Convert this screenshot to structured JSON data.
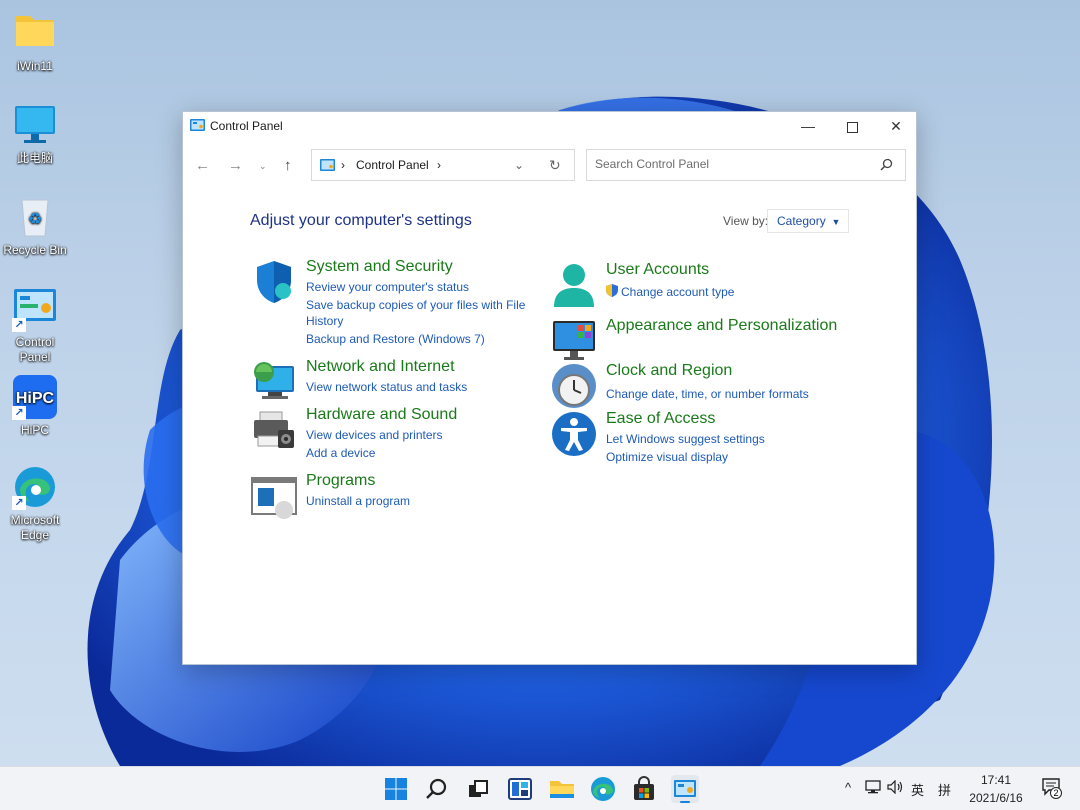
{
  "desktop_icons": [
    {
      "label": "iWin11",
      "icon": "folder-icon"
    },
    {
      "label": "此电脑",
      "icon": "monitor-icon"
    },
    {
      "label": "Recycle Bin",
      "icon": "recycle-bin-icon"
    },
    {
      "label": "Control Panel",
      "icon": "control-panel-icon"
    },
    {
      "label": "HiPC",
      "icon": "hipc-icon"
    },
    {
      "label": "Microsoft Edge",
      "icon": "edge-icon"
    }
  ],
  "window": {
    "title": "Control Panel",
    "address": {
      "crumb": "Control Panel"
    },
    "search": {
      "placeholder": "Search Control Panel"
    },
    "heading": "Adjust your computer's settings",
    "view_by": {
      "label": "View by:",
      "value": "Category"
    }
  },
  "categories": {
    "system_security": {
      "title": "System and Security",
      "links": [
        "Review your computer's status",
        "Save backup copies of your files with File",
        "History",
        "Backup and Restore (Windows 7)"
      ]
    },
    "network": {
      "title": "Network and Internet",
      "links": [
        "View network status and tasks"
      ]
    },
    "hardware": {
      "title": "Hardware and Sound",
      "links": [
        "View devices and printers",
        "Add a device"
      ]
    },
    "programs": {
      "title": "Programs",
      "links": [
        "Uninstall a program"
      ]
    },
    "user_accounts": {
      "title": "User Accounts",
      "links": [
        "Change account type"
      ]
    },
    "appearance": {
      "title": "Appearance and Personalization",
      "links": []
    },
    "clock": {
      "title": "Clock and Region",
      "links": [
        "Change date, time, or number formats"
      ]
    },
    "ease": {
      "title": "Ease of Access",
      "links": [
        "Let Windows suggest settings",
        "Optimize visual display"
      ]
    }
  },
  "taskbar": {
    "tray": {
      "ime_lang": "英",
      "ime_mode": "拼",
      "notification_count": "2"
    },
    "clock": {
      "time": "17:41",
      "date": "2021/6/16"
    }
  },
  "colors": {
    "category_title": "#1a7a1a",
    "link": "#1e5bb5",
    "heading": "#1e3287",
    "wallpaper_bloom": "#1b52d6"
  }
}
